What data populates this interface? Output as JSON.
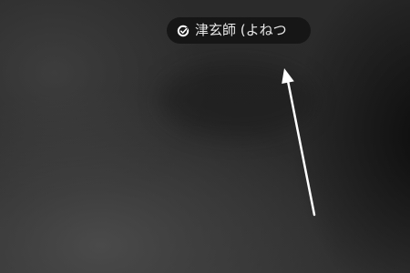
{
  "status_pill": {
    "icon": "ring-check-icon",
    "text": "津玄師 (よねつ",
    "background": "#161616",
    "text_color": "#e8e8e8"
  },
  "annotation": {
    "type": "arrow",
    "color": "#ffffff"
  }
}
